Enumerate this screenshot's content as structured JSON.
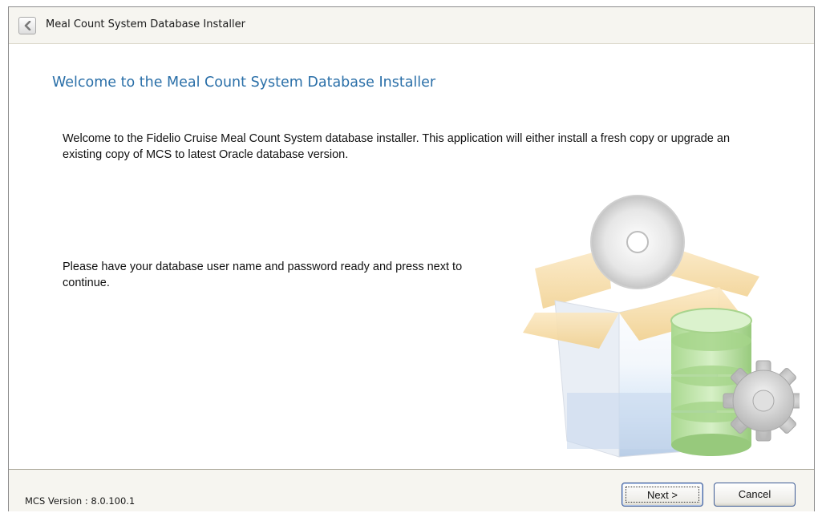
{
  "window": {
    "title": "Meal Count System Database Installer"
  },
  "content": {
    "heading": "Welcome to the Meal Count System Database Installer",
    "intro": "Welcome to the Fidelio Cruise Meal Count System database installer.  This application will either install a fresh copy or upgrade an existing copy of MCS to latest Oracle database version.",
    "ready": "Please have your database user name and password ready and press next to continue."
  },
  "footer": {
    "version": "MCS Version : 8.0.100.1",
    "next_label": "Next >",
    "cancel_label": "Cancel"
  },
  "icons": {
    "back": "chevron-left-icon",
    "illustration": "installer-box-database-icon"
  },
  "colors": {
    "heading": "#2a6fa8",
    "accent_border": "#3c5a94"
  }
}
